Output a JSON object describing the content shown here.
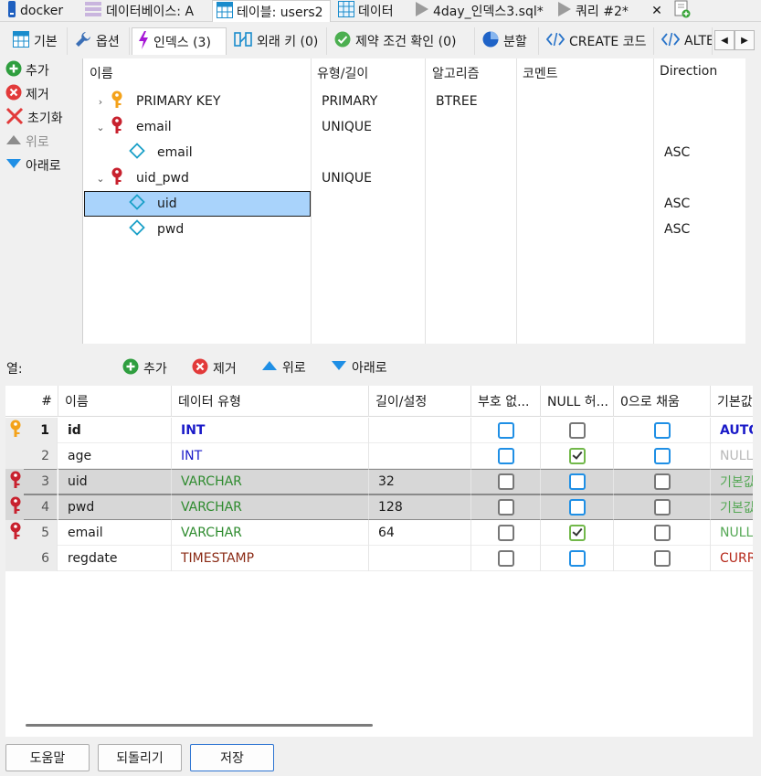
{
  "colors": {
    "accent": "#1f8fe5",
    "selection": "#a9d3fb",
    "key_primary": "#f4a21a",
    "key_other": "#c8212e"
  },
  "doc_tabs": [
    {
      "label": "docker",
      "icon": "server-icon",
      "active": false
    },
    {
      "label": "데이터베이스: A",
      "icon": "database-icon",
      "active": false
    },
    {
      "label": "테이블: users2",
      "icon": "table-icon",
      "active": true
    },
    {
      "label": "데이터",
      "icon": "grid-icon",
      "active": false
    },
    {
      "label": "4day_인덱스3.sql*",
      "icon": "play-icon",
      "active": false
    },
    {
      "label": "쿼리 #2*",
      "icon": "play-icon",
      "active": false
    },
    {
      "label": "✕",
      "icon": "close-icon",
      "active": false
    },
    {
      "label": "",
      "icon": "new-query-icon",
      "active": false
    }
  ],
  "sub_tabs": [
    {
      "label": "기본",
      "icon": "table-icon"
    },
    {
      "label": "옵션",
      "icon": "wrench-icon"
    },
    {
      "label": "인덱스 (3)",
      "icon": "lightning-icon"
    },
    {
      "label": "외래 키 (0)",
      "icon": "foreign-key-icon"
    },
    {
      "label": "제약 조건 확인 (0)",
      "icon": "check-circle-icon"
    },
    {
      "label": "분할",
      "icon": "pie-icon"
    },
    {
      "label": "CREATE 코드",
      "icon": "code-icon"
    },
    {
      "label": "ALTER",
      "icon": "code-icon"
    }
  ],
  "index_actions": [
    {
      "label": "추가",
      "icon": "add-icon",
      "enabled": true
    },
    {
      "label": "제거",
      "icon": "remove-icon",
      "enabled": true
    },
    {
      "label": "초기화",
      "icon": "clear-icon",
      "enabled": true
    },
    {
      "label": "위로",
      "icon": "up-icon",
      "enabled": false
    },
    {
      "label": "아래로",
      "icon": "down-icon",
      "enabled": true
    }
  ],
  "index_tree": {
    "headers": [
      "이름",
      "유형/길이",
      "알고리즘",
      "코멘트",
      "Direction"
    ],
    "rows": [
      {
        "name": "PRIMARY KEY",
        "type": "PRIMARY",
        "algorithm": "BTREE",
        "comment": "",
        "direction": ""
      },
      {
        "name": "email",
        "type": "UNIQUE",
        "algorithm": "",
        "comment": "",
        "direction": ""
      },
      {
        "name": "email",
        "type": "",
        "algorithm": "",
        "comment": "",
        "direction": "ASC"
      },
      {
        "name": "uid_pwd",
        "type": "UNIQUE",
        "algorithm": "",
        "comment": "",
        "direction": ""
      },
      {
        "name": "uid",
        "type": "",
        "algorithm": "",
        "comment": "",
        "direction": "ASC"
      },
      {
        "name": "pwd",
        "type": "",
        "algorithm": "",
        "comment": "",
        "direction": "ASC"
      }
    ]
  },
  "columns_toolbar": {
    "title": "열:",
    "add": "추가",
    "remove": "제거",
    "up": "위로",
    "down": "아래로"
  },
  "columns_grid": {
    "headers": [
      "#",
      "이름",
      "데이터 유형",
      "길이/설정",
      "부호 없...",
      "NULL 허...",
      "0으로 채움",
      "기본값"
    ],
    "rows": [
      {
        "num": "1",
        "name": "id",
        "type": "INT",
        "length": "",
        "unsigned": false,
        "nullable": false,
        "zerofill": false,
        "default": "AUTO_INCREMENT"
      },
      {
        "num": "2",
        "name": "age",
        "type": "INT",
        "length": "",
        "unsigned": false,
        "nullable": true,
        "zerofill": false,
        "default": "NULL"
      },
      {
        "num": "3",
        "name": "uid",
        "type": "VARCHAR",
        "length": "32",
        "unsigned": false,
        "nullable": false,
        "zerofill": false,
        "default": "기본값 없음"
      },
      {
        "num": "4",
        "name": "pwd",
        "type": "VARCHAR",
        "length": "128",
        "unsigned": false,
        "nullable": false,
        "zerofill": false,
        "default": "기본값 없음"
      },
      {
        "num": "5",
        "name": "email",
        "type": "VARCHAR",
        "length": "64",
        "unsigned": false,
        "nullable": true,
        "zerofill": false,
        "default": "NULL"
      },
      {
        "num": "6",
        "name": "regdate",
        "type": "TIMESTAMP",
        "length": "",
        "unsigned": false,
        "nullable": false,
        "zerofill": false,
        "default": "CURRENT_TIMESTAMP"
      }
    ]
  },
  "buttons": {
    "help": "도움말",
    "discard": "되돌리기",
    "save": "저장"
  }
}
